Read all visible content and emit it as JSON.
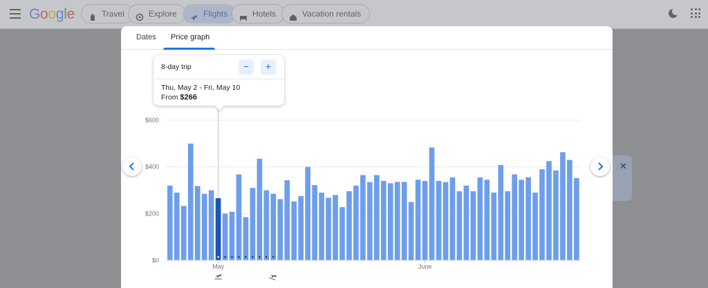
{
  "header": {
    "logo": "Google",
    "nav": [
      {
        "label": "Travel",
        "icon": "suitcase-icon"
      },
      {
        "label": "Explore",
        "icon": "explore-icon"
      },
      {
        "label": "Flights",
        "icon": "plane-icon",
        "active": true
      },
      {
        "label": "Hotels",
        "icon": "bed-icon"
      },
      {
        "label": "Vacation rentals",
        "icon": "house-icon"
      }
    ]
  },
  "modal": {
    "tabs": [
      {
        "label": "Dates"
      },
      {
        "label": "Price graph",
        "active": true
      }
    ]
  },
  "tooltip": {
    "trip_length": "8-day trip",
    "minus": "−",
    "plus": "+",
    "dates": "Thu, May 2 - Fri, May 10",
    "from_label": "From",
    "price": "$266"
  },
  "colors": {
    "bar": "#6d9eeb",
    "bar_selected": "#1a56b8",
    "accent": "#1a73e8"
  },
  "chart_data": {
    "type": "bar",
    "ylim": [
      0,
      600
    ],
    "yticks": [
      "$0",
      "$200",
      "$400",
      "$600"
    ],
    "ytick_values": [
      0,
      200,
      400,
      600
    ],
    "month_labels": [
      {
        "label": "May",
        "index": 7
      },
      {
        "label": "June",
        "index": 37
      }
    ],
    "selected_index": 7,
    "trip_span_indices": [
      7,
      8,
      9,
      10,
      11,
      12,
      13,
      14,
      15
    ],
    "departure_index": 7,
    "return_index": 15,
    "values": [
      320,
      290,
      233,
      500,
      318,
      285,
      300,
      266,
      200,
      208,
      368,
      185,
      310,
      435,
      300,
      285,
      262,
      343,
      252,
      275,
      400,
      322,
      290,
      268,
      280,
      228,
      296,
      320,
      365,
      335,
      365,
      340,
      330,
      336,
      336,
      250,
      345,
      340,
      483,
      340,
      335,
      355,
      296,
      320,
      296,
      355,
      345,
      290,
      408,
      296,
      368,
      345,
      356,
      290,
      390,
      425,
      385,
      463,
      430,
      352
    ]
  }
}
